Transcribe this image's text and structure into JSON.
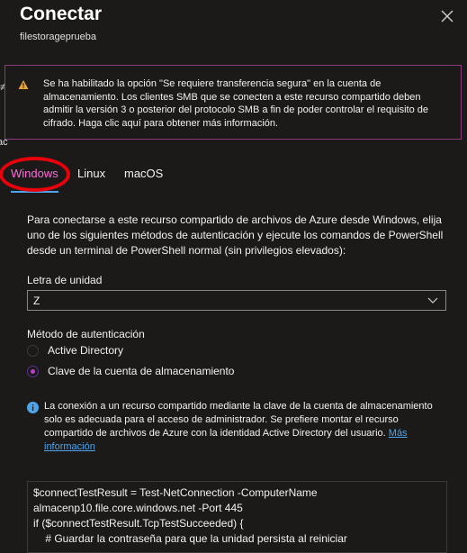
{
  "header": {
    "title": "Conectar",
    "subtitle": "filestorageprueba"
  },
  "left_edge_fragments": [
    "≠",
    "ac"
  ],
  "banner": {
    "text": "Se ha habilitado la opción \"Se requiere transferencia segura\" en la cuenta de almacenamiento. Los clientes SMB que se conecten a este recurso compartido deben admitir la versión 3 o posterior del protocolo SMB a fin de poder controlar el requisito de cifrado. Haga clic aquí para obtener más información.",
    "icon": "warning-icon",
    "border_color": "#8a3a7c"
  },
  "tabs": [
    {
      "label": "Windows",
      "active": true
    },
    {
      "label": "Linux",
      "active": false
    },
    {
      "label": "macOS",
      "active": false
    }
  ],
  "description": "Para conectarse a este recurso compartido de archivos de Azure desde Windows, elija uno de los siguientes métodos de autenticación y ejecute los comandos de PowerShell desde un terminal de PowerShell normal (sin privilegios elevados):",
  "drive_letter": {
    "label": "Letra de unidad",
    "value": "Z"
  },
  "auth": {
    "label": "Método de autenticación",
    "options": [
      {
        "label": "Active Directory",
        "selected": false
      },
      {
        "label": "Clave de la cuenta de almacenamiento",
        "selected": true
      }
    ]
  },
  "info": {
    "text": "La conexión a un recurso compartido mediante la clave de la cuenta de almacenamiento solo es adecuada para el acceso de administrador. Se prefiere montar el recurso compartido de archivos de Azure con la identidad Active Directory del usuario.",
    "link": "Más información"
  },
  "code_lines": [
    "$connectTestResult = Test-NetConnection -ComputerName",
    "almacenp10.file.core.windows.net -Port 445",
    "if ($connectTestResult.TcpTestSucceeded) {",
    "    # Guardar la contraseña para que la unidad persista al reiniciar"
  ],
  "colors": {
    "accent": "#4fa3e8",
    "active_tab": "#ff6bd9",
    "annotation": "#e8000b",
    "radio_selected": "#b146c2"
  }
}
